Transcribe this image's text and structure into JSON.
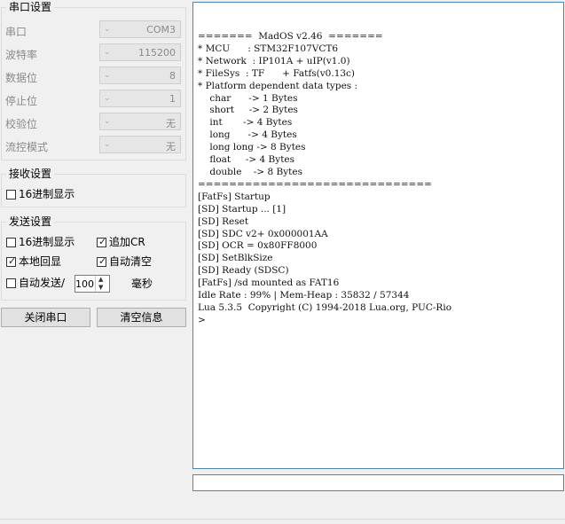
{
  "serial_settings": {
    "title": "串口设置",
    "rows": [
      {
        "label": "串口",
        "value": "COM3"
      },
      {
        "label": "波特率",
        "value": "115200"
      },
      {
        "label": "数据位",
        "value": "8"
      },
      {
        "label": "停止位",
        "value": "1"
      },
      {
        "label": "校验位",
        "value": "无"
      },
      {
        "label": "流控模式",
        "value": "无"
      }
    ]
  },
  "receive_settings": {
    "title": "接收设置",
    "hex_display": {
      "label": "16进制显示",
      "checked": false
    }
  },
  "send_settings": {
    "title": "发送设置",
    "hex_display": {
      "label": "16进制显示",
      "checked": false
    },
    "append_cr": {
      "label": "追加CR",
      "checked": true
    },
    "local_echo": {
      "label": "本地回显",
      "checked": true
    },
    "auto_clear": {
      "label": "自动清空",
      "checked": true
    },
    "auto_send": {
      "label": "自动发送/",
      "checked": false
    },
    "interval_value": "100",
    "interval_unit": "毫秒"
  },
  "buttons": {
    "close_port": "关闭串口",
    "clear_info": "清空信息"
  },
  "terminal": {
    "text": "=======  MadOS v2.46  =======\n* MCU      : STM32F107VCT6\n* Network  : IP101A + uIP(v1.0)\n* FileSys  : TF      + Fatfs(v0.13c)\n* Platform dependent data types :\n    char      -> 1 Bytes\n    short     -> 2 Bytes\n    int       -> 4 Bytes\n    long      -> 4 Bytes\n    long long -> 8 Bytes\n    float     -> 4 Bytes\n    double    -> 8 Bytes\n==============================\n[FatFs] Startup\n[SD] Startup ... [1]\n[SD] Reset\n[SD] SDC v2+ 0x000001AA\n[SD] OCR = 0x80FF8000\n[SD] SetBlkSize\n[SD] Ready (SDSC)\n[FatFs] /sd mounted as FAT16\nIdle Rate : 99% | Mem-Heap : 35832 / 57344\nLua 5.3.5  Copyright (C) 1994-2018 Lua.org, PUC-Rio\n>"
  },
  "send_input": {
    "value": ""
  }
}
